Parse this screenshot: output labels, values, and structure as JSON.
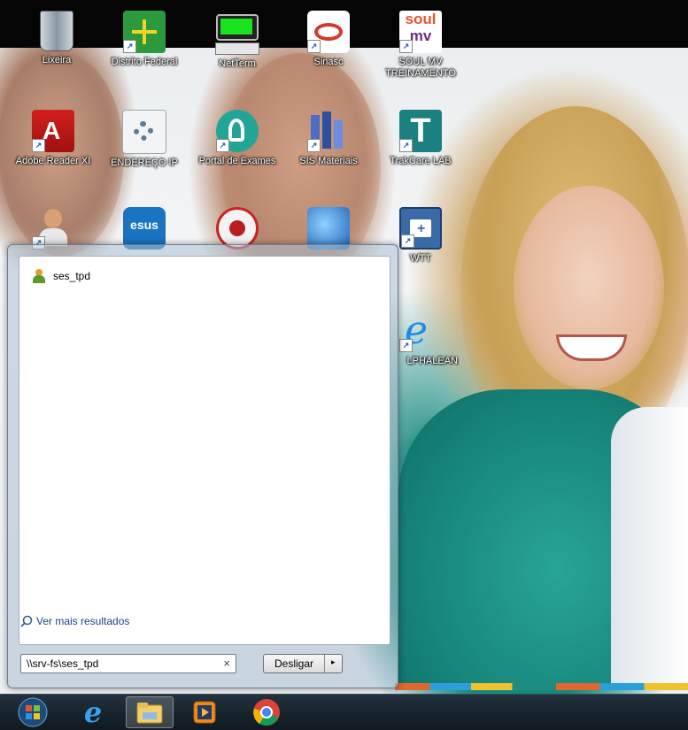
{
  "desktop": {
    "icons": [
      {
        "label": "Lixeira",
        "icon": "recycle-bin-icon"
      },
      {
        "label": "Distrito Federal",
        "icon": "flag-icon"
      },
      {
        "label": "NetTerm",
        "icon": "terminal-icon"
      },
      {
        "label": "Sinasc",
        "icon": "sinasc-icon"
      },
      {
        "label": "SOUL MV",
        "label2": "TREINAMENTO",
        "icon": "soul-mv-icon",
        "logo_top": "soul",
        "logo_bottom": "mv"
      },
      {
        "label": "Adobe Reader XI",
        "icon": "adobe-reader-icon"
      },
      {
        "label": "ENDEREÇO IP",
        "icon": "network-gear-icon"
      },
      {
        "label": "Portal de Exames",
        "icon": "microscope-icon"
      },
      {
        "label": "SIS Materiais",
        "icon": "sis-materiais-icon"
      },
      {
        "label": "TrakCare LAB",
        "icon": "trakcare-icon",
        "logo": "T"
      },
      {
        "label": "",
        "icon": "support-agent-icon"
      },
      {
        "label": "",
        "icon": "esus-icon",
        "logo": "esus"
      },
      {
        "label": "",
        "icon": "radiation-icon"
      },
      {
        "label": "",
        "icon": "globe-icon"
      },
      {
        "label": "WTT",
        "icon": "wtt-folder-icon"
      },
      {
        "label": "LPHALEAN",
        "icon": "internet-explorer-icon"
      }
    ]
  },
  "start_menu": {
    "result": {
      "label": "ses_tpd",
      "icon": "user-folder-icon"
    },
    "more_results": "Ver mais resultados",
    "search": {
      "value": "\\\\srv-fs\\ses_tpd"
    },
    "clear_symbol": "×",
    "shutdown_label": "Desligar",
    "shutdown_arrow": "▸"
  },
  "taskbar": {
    "items": [
      "start-orb",
      "internet-explorer",
      "windows-explorer",
      "media-player",
      "chrome"
    ],
    "active": "windows-explorer"
  }
}
